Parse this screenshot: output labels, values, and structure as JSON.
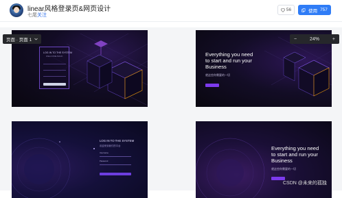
{
  "header": {
    "title": "linear风格登录页&网页设计",
    "author": "七尾",
    "follow_label": "关注",
    "like_count": "56",
    "use_label": "使用",
    "use_count": "757",
    "accent_color": "#2f7cf6"
  },
  "toolbar": {
    "page_select": "页面 · 页面 1",
    "zoom_level": "24%",
    "zoom_out": "−",
    "zoom_in": "+"
  },
  "frames": {
    "login_card": {
      "title": "LOG IN TO THE SYSTEM",
      "subtitle": "WELCOME BACK"
    },
    "hero": {
      "line1": "Everything you need",
      "line2": "to start and run your",
      "line3": "Business",
      "sub": "就这些你需要的一切"
    },
    "login_page": {
      "title": "LOG IN TO THE SYSTEM",
      "subtitle": "欢迎来到我们的平台",
      "field1": "Username",
      "field2": "Password"
    }
  },
  "watermark": "CSDN @未来的孤独"
}
